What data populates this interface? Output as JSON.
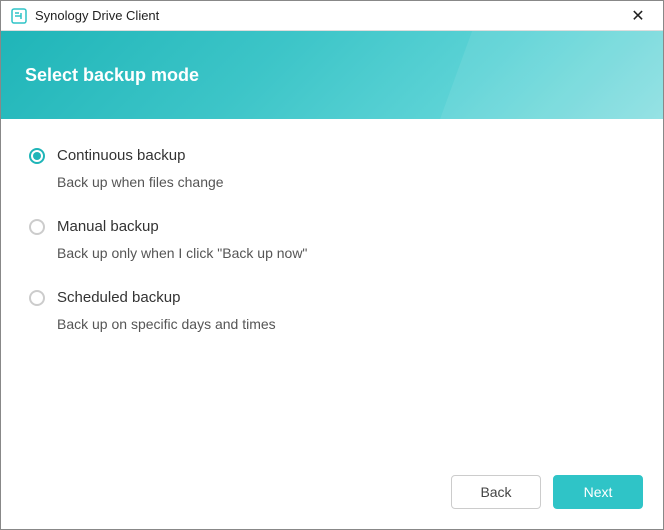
{
  "titlebar": {
    "app_name": "Synology Drive Client"
  },
  "header": {
    "title": "Select backup mode"
  },
  "options": {
    "continuous": {
      "label": "Continuous backup",
      "description": "Back up when files change",
      "selected": true
    },
    "manual": {
      "label": "Manual backup",
      "description": "Back up only when I click \"Back up now\"",
      "selected": false
    },
    "scheduled": {
      "label": "Scheduled backup",
      "description": "Back up on specific days and times",
      "selected": false
    }
  },
  "footer": {
    "back_label": "Back",
    "next_label": "Next"
  },
  "colors": {
    "accent": "#1fb5b8",
    "primary_button": "#2fc4c7"
  }
}
